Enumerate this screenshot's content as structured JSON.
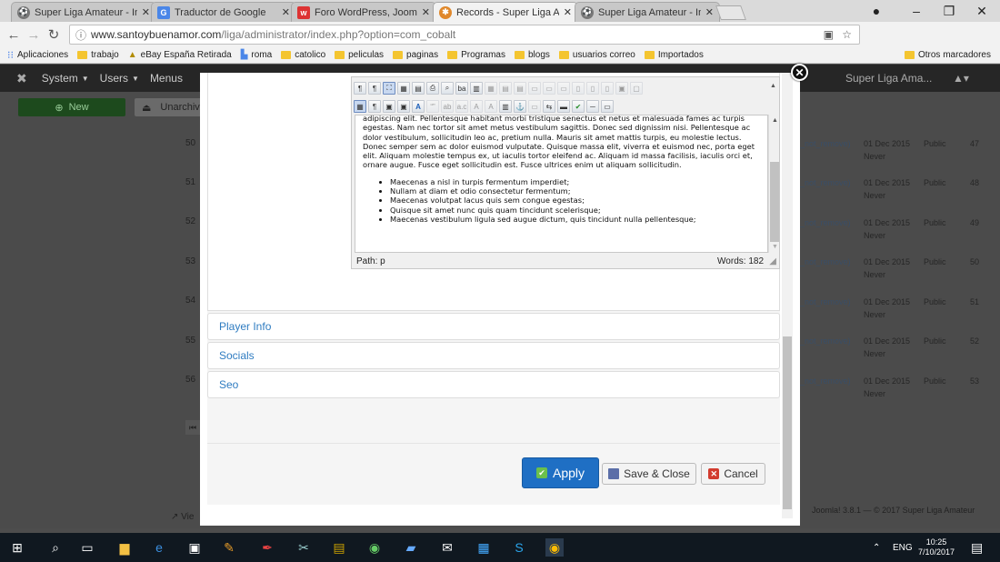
{
  "browser": {
    "tabs": [
      {
        "title": "Super Liga Amateur - Ini",
        "icon": "soccer-ball-icon",
        "active": false
      },
      {
        "title": "Traductor de Google",
        "icon": "google-translate-icon",
        "active": false
      },
      {
        "title": "Foro WordPress, Joomla",
        "icon": "forum-icon",
        "active": false
      },
      {
        "title": "Records - Super Liga Am",
        "icon": "joomla-icon",
        "active": true
      },
      {
        "title": "Super Liga Amateur - Ini",
        "icon": "soccer-ball-icon",
        "active": false
      }
    ],
    "url_host": "www.santoybuenamor.com",
    "url_path": "/liga/administrator/index.php?option=com_cobalt",
    "bookmarks": [
      {
        "label": "Aplicaciones",
        "icon": "apps-grid-icon"
      },
      {
        "label": "trabajo",
        "icon": "folder-icon"
      },
      {
        "label": "eBay España Retirada",
        "icon": "ebay-icon"
      },
      {
        "label": "roma",
        "icon": "google-translate-icon"
      },
      {
        "label": "catolico",
        "icon": "folder-icon"
      },
      {
        "label": "peliculas",
        "icon": "folder-icon"
      },
      {
        "label": "paginas",
        "icon": "folder-icon"
      },
      {
        "label": "Programas",
        "icon": "folder-icon"
      },
      {
        "label": "blogs",
        "icon": "folder-icon"
      },
      {
        "label": "usuarios correo",
        "icon": "folder-icon"
      },
      {
        "label": "Importados",
        "icon": "folder-icon"
      }
    ],
    "other_bookmarks": "Otros marcadores"
  },
  "joomla": {
    "menu": [
      "System",
      "Users",
      "Menus"
    ],
    "site_name": "Super Liga Ama...",
    "new_label": "New",
    "unarchive_label": "Unarchive",
    "rows": [
      {
        "id": "50",
        "alias": "_not_remove)",
        "date": "01 Dec 2015",
        "access": "Public",
        "num": "47",
        "expires": "Never"
      },
      {
        "id": "51",
        "alias": "_not_remove)",
        "date": "01 Dec 2015",
        "access": "Public",
        "num": "48",
        "expires": "Never"
      },
      {
        "id": "52",
        "alias": "_not_remove)",
        "date": "01 Dec 2015",
        "access": "Public",
        "num": "49",
        "expires": "Never"
      },
      {
        "id": "53",
        "alias": "_not_remove)",
        "date": "01 Dec 2015",
        "access": "Public",
        "num": "50",
        "expires": "Never"
      },
      {
        "id": "54",
        "alias": "_not_remove)",
        "date": "01 Dec 2015",
        "access": "Public",
        "num": "51",
        "expires": "Never"
      },
      {
        "id": "55",
        "alias": "_not_remove)",
        "date": "01 Dec 2015",
        "access": "Public",
        "num": "52",
        "expires": "Never"
      },
      {
        "id": "56",
        "alias": "_not_remove)",
        "date": "01 Dec 2015",
        "access": "Public",
        "num": "53",
        "expires": "Never"
      }
    ],
    "footer": "Joomla! 3.8.1 — © 2017 Super Liga Amateur",
    "view_label": "Vie"
  },
  "modal": {
    "editor_paragraph": "adipiscing elit. Pellentesque habitant morbi tristique senectus et netus et malesuada fames ac turpis egestas. Nam nec tortor sit amet metus vestibulum sagittis. Donec sed dignissim nisi. Pellentesque ac dolor vestibulum, sollicitudin leo ac, pretium nulla. Mauris sit amet mattis turpis, eu molestie lectus. Donec semper sem ac dolor euismod vulputate. Quisque massa elit, viverra et euismod nec, porta eget elit. Aliquam molestie tempus ex, ut iaculis tortor eleifend ac. Aliquam id massa facilisis, iaculis orci et, ornare augue. Fusce eget sollicitudin est. Fusce ultrices enim ut aliquam sollicitudin.",
    "editor_list": [
      "Maecenas a nisl in turpis fermentum imperdiet;",
      "Nullam at diam et odio consectetur fermentum;",
      "Maecenas volutpat lacus quis sem congue egestas;",
      "Quisque sit amet nunc quis quam tincidunt scelerisque;",
      "Maecenas vestibulum ligula sed augue dictum, quis tincidunt nulla pellentesque;"
    ],
    "path_label": "Path:",
    "path_value": "p",
    "words_label": "Words: 182",
    "sections": [
      "Player Info",
      "Socials",
      "Seo"
    ],
    "apply_label": "Apply",
    "save_close_label": "Save & Close",
    "cancel_label": "Cancel"
  },
  "taskbar": {
    "lang": "ENG",
    "time": "10:25",
    "date": "7/10/2017"
  }
}
